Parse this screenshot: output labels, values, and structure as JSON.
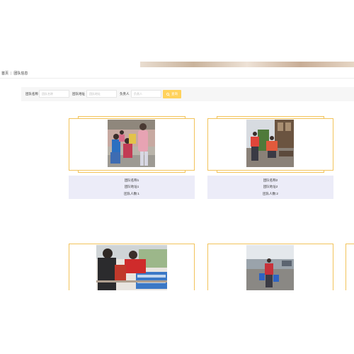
{
  "breadcrumb": {
    "home": "首页",
    "separator": "|",
    "current": "团队信息"
  },
  "filters": {
    "team_name_label": "团队名称",
    "team_name_placeholder": "团队名称",
    "team_address_label": "团队地址",
    "team_address_placeholder": "团队地址",
    "leader_label": "负责人",
    "leader_placeholder": "负责人",
    "search_label": "查询",
    "search_icon": "search-icon"
  },
  "teams": [
    {
      "name": "团队名称1",
      "address": "团队地址1",
      "count": "团队人数:1"
    },
    {
      "name": "团队名称2",
      "address": "团队地址2",
      "count": "团队人数:2"
    }
  ],
  "colors": {
    "accent": "#ffd25c",
    "card_border": "#f2c35a",
    "info_bg": "#ececf8"
  }
}
